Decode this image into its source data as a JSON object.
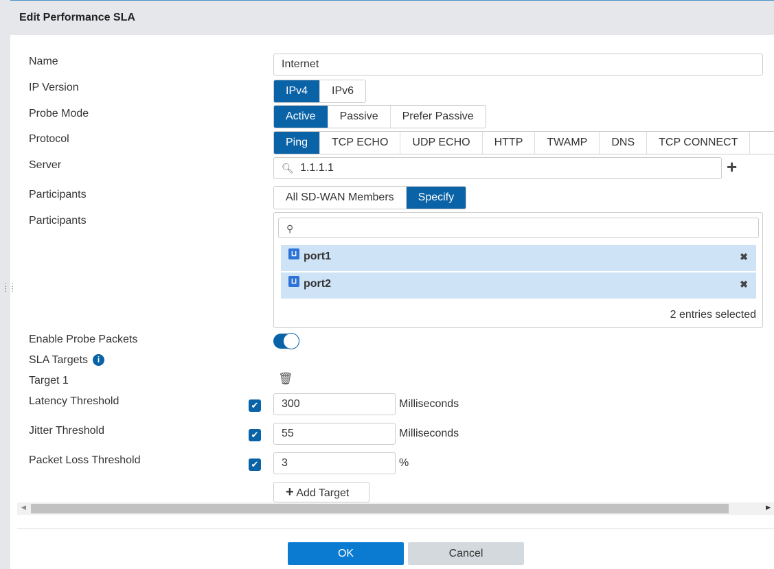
{
  "title": "Edit Performance SLA",
  "labels": {
    "name": "Name",
    "ip_version": "IP Version",
    "probe_mode": "Probe Mode",
    "protocol": "Protocol",
    "server": "Server",
    "participants": "Participants",
    "participants2": "Participants",
    "enable_probe": "Enable Probe Packets",
    "sla_targets": "SLA Targets",
    "target1": "Target 1",
    "latency": "Latency Threshold",
    "jitter": "Jitter Threshold",
    "packet_loss": "Packet Loss Threshold"
  },
  "name_value": "Internet",
  "ip_version": [
    "IPv4",
    "IPv6"
  ],
  "probe_mode": [
    "Active",
    "Passive",
    "Prefer Passive"
  ],
  "protocol": [
    "Ping",
    "TCP ECHO",
    "UDP ECHO",
    "HTTP",
    "TWAMP",
    "DNS",
    "TCP CONNECT"
  ],
  "server_value": "1.1.1.1",
  "participants_mode": [
    "All SD-WAN Members",
    "Specify"
  ],
  "participants": [
    "port1",
    "port2"
  ],
  "entries_selected": "2 entries selected",
  "latency": {
    "value": "300",
    "unit": "Milliseconds"
  },
  "jitter": {
    "value": "55",
    "unit": "Milliseconds"
  },
  "packet_loss": {
    "value": "3",
    "unit": "%"
  },
  "add_target": "Add Target",
  "ok": "OK",
  "cancel": "Cancel",
  "accent": "#0a63a6"
}
